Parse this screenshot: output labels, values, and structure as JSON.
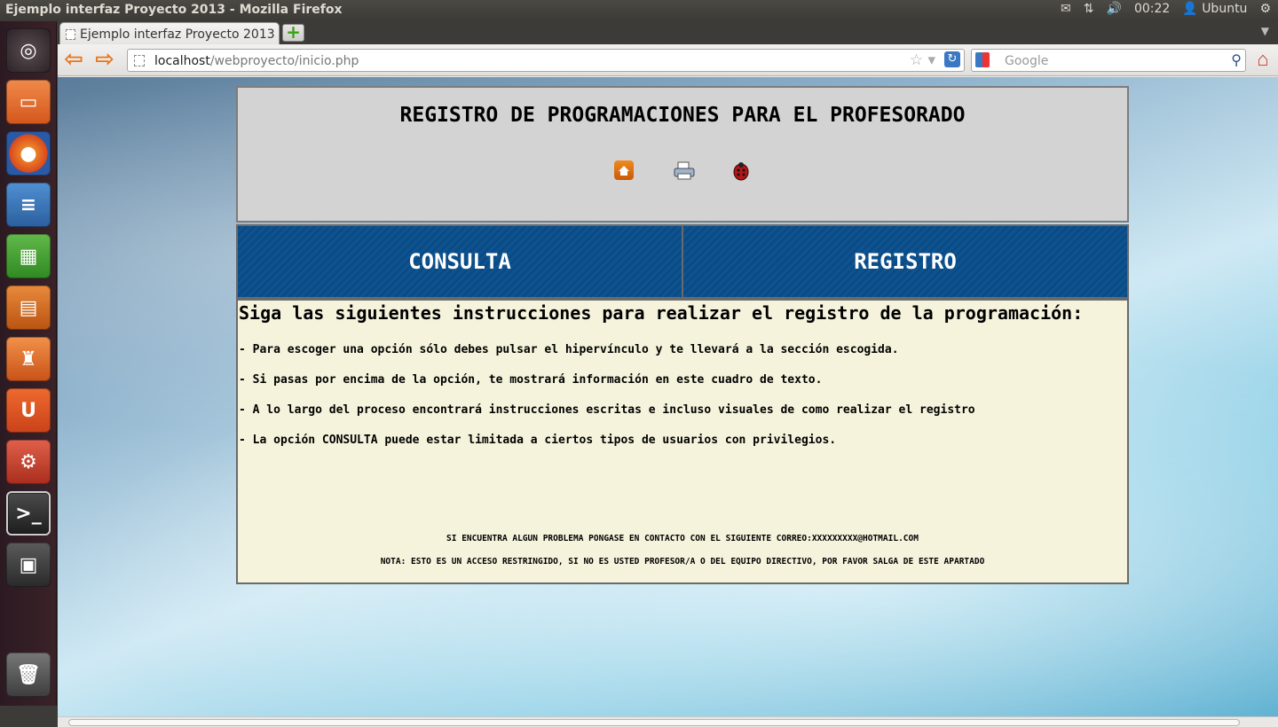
{
  "window": {
    "title": "Ejemplo interfaz Proyecto 2013 - Mozilla Firefox",
    "clock": "00:22",
    "user": "Ubuntu"
  },
  "launcher": {
    "items": [
      "ubuntu-dash-icon",
      "files-icon",
      "firefox-icon",
      "writer-icon",
      "calc-icon",
      "impress-icon",
      "software-center-icon",
      "ubuntu-one-icon",
      "system-settings-icon",
      "terminal-icon",
      "workspace-switcher-icon",
      "trash-icon"
    ]
  },
  "browser": {
    "tab_title": "Ejemplo interfaz Proyecto 2013",
    "url_host": "localhost",
    "url_path": "/webproyecto/inicio.php",
    "search_placeholder": "Google"
  },
  "page": {
    "title": "REGISTRO DE PROGRAMACIONES PARA EL PROFESORADO",
    "header_icons": [
      "home-icon",
      "printer-icon",
      "ladybug-icon"
    ],
    "menu": [
      {
        "label": "CONSULTA"
      },
      {
        "label": "REGISTRO"
      }
    ],
    "info_title": "Siga las siguientes instrucciones para realizar el registro de la programación:",
    "instructions": [
      "- Para escoger una opción sólo debes pulsar el hipervínculo y te llevará a la sección escogida.",
      "- Si pasas por encima de la opción, te mostrará información en este cuadro de texto.",
      "- A lo largo del proceso encontrará instrucciones escritas e incluso visuales de como realizar el registro",
      "- La opción CONSULTA puede estar limitada a ciertos tipos de usuarios con privilegios."
    ],
    "footer_contact": "SI ENCUENTRA ALGUN PROBLEMA PONGASE EN CONTACTO CON EL SIGUIENTE CORREO:XXXXXXXXX@HOTMAIL.COM",
    "footer_note": "NOTA: ESTO ES UN ACCESO RESTRINGIDO, SI NO ES USTED PROFESOR/A O DEL EQUIPO DIRECTIVO, POR FAVOR SALGA DE ESTE APARTADO"
  },
  "colors": {
    "menu_bg": "#0b4a86",
    "header_bg": "#d3d3d3",
    "info_bg": "#f5f3dc"
  }
}
